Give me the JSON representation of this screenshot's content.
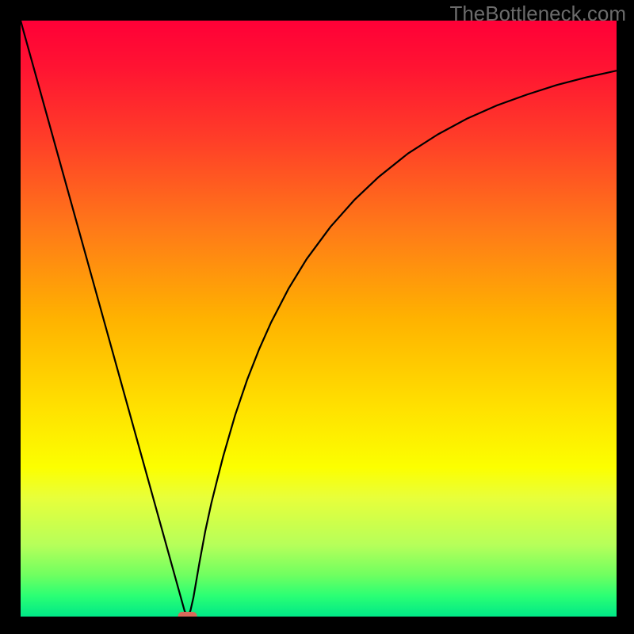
{
  "watermark": "TheBottleneck.com",
  "colors": {
    "frame": "#000000",
    "curve": "#000000",
    "marker": "#d86a5a",
    "gradient_stops": [
      {
        "offset": 0.0,
        "color": "#ff0037"
      },
      {
        "offset": 0.08,
        "color": "#ff1432"
      },
      {
        "offset": 0.2,
        "color": "#ff3e28"
      },
      {
        "offset": 0.35,
        "color": "#ff7a18"
      },
      {
        "offset": 0.5,
        "color": "#ffb200"
      },
      {
        "offset": 0.65,
        "color": "#ffe100"
      },
      {
        "offset": 0.75,
        "color": "#fcff00"
      },
      {
        "offset": 0.8,
        "color": "#e8ff3a"
      },
      {
        "offset": 0.88,
        "color": "#b6ff5a"
      },
      {
        "offset": 0.93,
        "color": "#70ff60"
      },
      {
        "offset": 0.965,
        "color": "#2bff74"
      },
      {
        "offset": 1.0,
        "color": "#00e887"
      }
    ]
  },
  "chart_data": {
    "type": "line",
    "title": "",
    "xlabel": "",
    "ylabel": "",
    "xlim": [
      0,
      100
    ],
    "ylim": [
      0,
      100
    ],
    "x": [
      0,
      2,
      4,
      6,
      8,
      10,
      12,
      14,
      16,
      18,
      20,
      22,
      24,
      26,
      27.5,
      28,
      28.5,
      29,
      30,
      31,
      32,
      33,
      34,
      36,
      38,
      40,
      42,
      45,
      48,
      52,
      56,
      60,
      65,
      70,
      75,
      80,
      85,
      90,
      95,
      100
    ],
    "values": [
      100,
      92.8,
      85.6,
      78.4,
      71.2,
      64,
      56.8,
      49.6,
      42.4,
      35.2,
      28,
      20.8,
      13.6,
      6.4,
      1,
      0,
      1,
      3.2,
      9,
      14.4,
      19,
      23,
      26.9,
      33.8,
      39.7,
      44.8,
      49.3,
      55.1,
      60,
      65.4,
      69.9,
      73.7,
      77.7,
      80.9,
      83.6,
      85.8,
      87.6,
      89.2,
      90.5,
      91.6
    ],
    "marker": {
      "x": 28,
      "y": 0,
      "shape": "rounded-rect"
    },
    "notes": "V-shaped bottleneck curve; linear descent from x≈0 to the minimum near x≈28, then a concave-increasing curve approaching ~92 at x=100. Axes are unlabeled; background is a vertical red→yellow→green gradient."
  }
}
